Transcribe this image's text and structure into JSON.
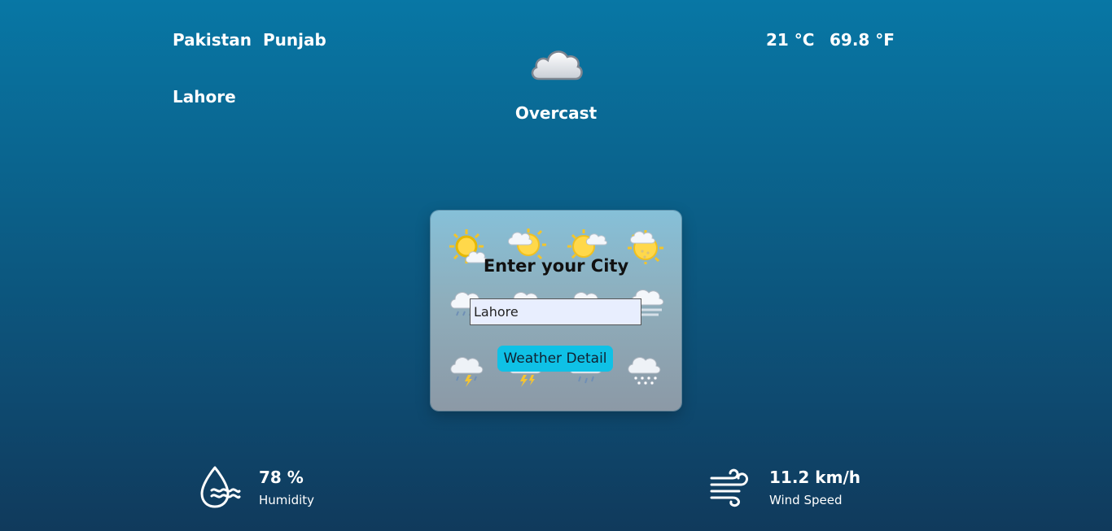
{
  "location": {
    "country": "Pakistan",
    "province": "Punjab",
    "city": "Lahore"
  },
  "temperature": {
    "celsius": "21 °C",
    "fahrenheit": "69.8 °F"
  },
  "condition": {
    "text": "Overcast",
    "icon": "cloud-icon"
  },
  "search": {
    "title": "Enter your City",
    "input_value": "Lahore",
    "button_label": "Weather Detail",
    "background_icons": [
      "sun-icon",
      "sun-cloud-icon",
      "sun-cloud-icon",
      "sun-snow-icon",
      "rain-cloud-icon",
      "rain-cloud-icon",
      "rain-cloud-icon",
      "fog-cloud-icon",
      "thunder-cloud-icon",
      "thunder-cloud-icon",
      "rain-cloud-icon",
      "snow-cloud-icon"
    ]
  },
  "stats": {
    "humidity": {
      "value": "78 %",
      "label": "Humidity",
      "icon": "humidity-icon"
    },
    "wind": {
      "value": "11.2 km/h",
      "label": "Wind Speed",
      "icon": "wind-icon"
    }
  },
  "colors": {
    "background_top": "#0877a5",
    "background_bottom": "#103a5c",
    "button": "#0fc1e6",
    "input_bg": "#e8eefe"
  }
}
